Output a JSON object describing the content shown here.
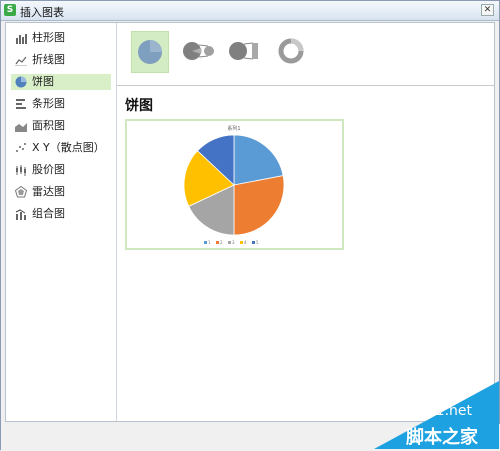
{
  "window": {
    "title": "插入图表",
    "app_icon_letter": "S"
  },
  "sidebar": {
    "items": [
      {
        "label": "柱形图",
        "icon": "column-chart-icon",
        "selected": false
      },
      {
        "label": "折线图",
        "icon": "line-chart-icon",
        "selected": false
      },
      {
        "label": "饼图",
        "icon": "pie-chart-icon",
        "selected": true
      },
      {
        "label": "条形图",
        "icon": "bar-chart-icon",
        "selected": false
      },
      {
        "label": "面积图",
        "icon": "area-chart-icon",
        "selected": false
      },
      {
        "label": "X Y（散点图）",
        "icon": "scatter-chart-icon",
        "selected": false
      },
      {
        "label": "股价图",
        "icon": "stock-chart-icon",
        "selected": false
      },
      {
        "label": "雷达图",
        "icon": "radar-chart-icon",
        "selected": false
      },
      {
        "label": "组合图",
        "icon": "combo-chart-icon",
        "selected": false
      }
    ]
  },
  "subtypes": [
    {
      "icon": "pie-subtype-icon",
      "selected": true
    },
    {
      "icon": "pie-of-pie-subtype-icon",
      "selected": false
    },
    {
      "icon": "bar-of-pie-subtype-icon",
      "selected": false
    },
    {
      "icon": "doughnut-subtype-icon",
      "selected": false
    }
  ],
  "section_title": "饼图",
  "preview": {
    "chart_title": "系列1",
    "legend_entries": [
      "1",
      "2",
      "3",
      "4",
      "5"
    ]
  },
  "chart_data": {
    "type": "pie",
    "title": "系列1",
    "categories": [
      "1",
      "2",
      "3",
      "4",
      "5"
    ],
    "values": [
      22,
      28,
      18,
      19,
      13
    ],
    "colors": [
      "#5b9bd5",
      "#ed7d31",
      "#a5a5a5",
      "#ffc000",
      "#4472c4"
    ]
  },
  "watermark": {
    "url": "jb51.net",
    "name": "脚本之家"
  },
  "colors": {
    "selected_bg": "#d9efc8",
    "accent_green": "#3aa948",
    "watermark_blue": "#1ea1e0"
  }
}
